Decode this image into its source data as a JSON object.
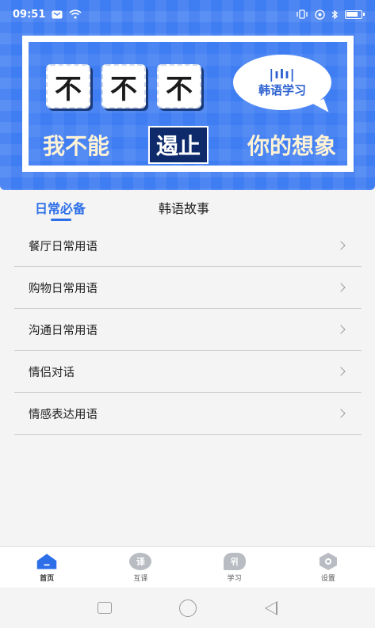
{
  "status_bar": {
    "time": "09:51",
    "left_icons": [
      "message-icon",
      "wifi-icon"
    ],
    "right_icons": [
      "vibrate-icon",
      "hotspot-icon",
      "bluetooth-icon",
      "battery-icon"
    ]
  },
  "banner": {
    "tiles": [
      "不",
      "不",
      "不"
    ],
    "bubble_text": "韩语学习",
    "slogan_parts": [
      "我不能",
      "遏止",
      "你的想象"
    ]
  },
  "tabs": [
    {
      "label": "日常必备",
      "active": true
    },
    {
      "label": "韩语故事",
      "active": false
    }
  ],
  "list": [
    {
      "label": "餐厅日常用语"
    },
    {
      "label": "购物日常用语"
    },
    {
      "label": "沟通日常用语"
    },
    {
      "label": "情侣对话"
    },
    {
      "label": "情感表达用语"
    }
  ],
  "bottom_nav": [
    {
      "label": "首页",
      "icon": "home-icon",
      "active": true
    },
    {
      "label": "互译",
      "icon": "translate-icon",
      "glyph": "译",
      "active": false
    },
    {
      "label": "学习",
      "icon": "study-icon",
      "glyph": "위",
      "active": false
    },
    {
      "label": "设置",
      "icon": "settings-icon",
      "active": false
    }
  ],
  "colors": {
    "accent": "#2d6fe8",
    "banner_bg": "#3f7df2",
    "inactive_icon": "#b9bcc2"
  }
}
